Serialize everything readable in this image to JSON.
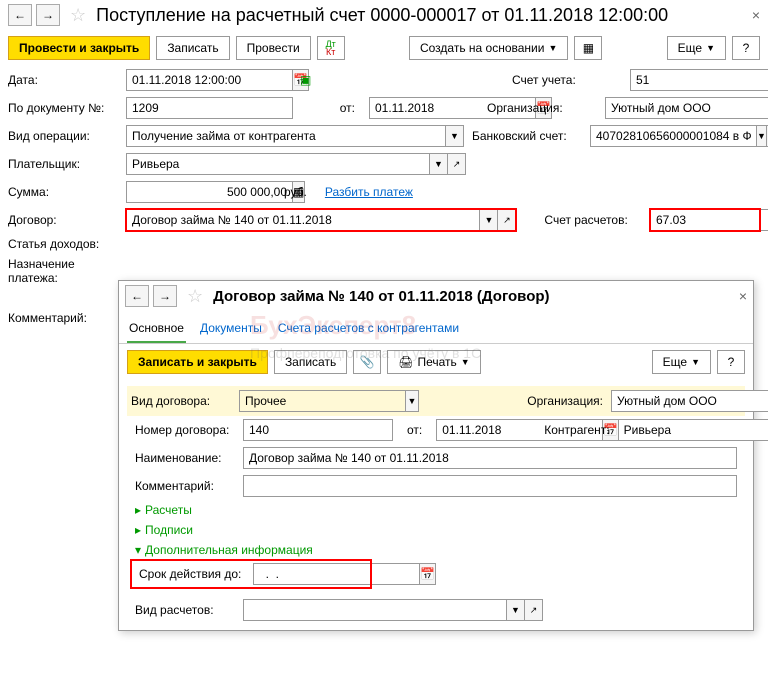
{
  "main": {
    "title": "Поступление на расчетный счет 0000-000017 от 01.11.2018 12:00:00",
    "actions": {
      "post_close": "Провести и закрыть",
      "save": "Записать",
      "post": "Провести",
      "create_based": "Создать на основании",
      "more": "Еще"
    },
    "fields": {
      "date_label": "Дата:",
      "date_value": "01.11.2018 12:00:00",
      "account_label": "Счет учета:",
      "account_value": "51",
      "docnum_label": "По документу №:",
      "docnum_value": "1209",
      "from_label": "от:",
      "from_value": "01.11.2018",
      "org_label": "Организация:",
      "org_value": "Уютный дом ООО",
      "optype_label": "Вид операции:",
      "optype_value": "Получение займа от контрагента",
      "bank_label": "Банковский счет:",
      "bank_value": "40702810656000001084 в Ф",
      "payer_label": "Плательщик:",
      "payer_value": "Ривьера",
      "sum_label": "Сумма:",
      "sum_value": "500 000,00",
      "currency": "руб.",
      "split_link": "Разбить платеж",
      "contract_label": "Договор:",
      "contract_value": "Договор займа № 140 от 01.11.2018",
      "settlement_label": "Счет расчетов:",
      "settlement_value": "67.03",
      "income_label": "Статья доходов:",
      "purpose_label": "Назначение платежа:",
      "comment_label": "Комментарий:"
    }
  },
  "dialog": {
    "title": "Договор займа № 140 от 01.11.2018 (Договор)",
    "tabs": {
      "main": "Основное",
      "docs": "Документы",
      "accounts": "Счета расчетов с контрагентами"
    },
    "actions": {
      "save_close": "Записать и закрыть",
      "save": "Записать",
      "print": "Печать",
      "more": "Еще"
    },
    "fields": {
      "type_label": "Вид договора:",
      "type_value": "Прочее",
      "org_label": "Организация:",
      "org_value": "Уютный дом ООО",
      "num_label": "Номер договора:",
      "num_value": "140",
      "from_label": "от:",
      "from_value": "01.11.2018",
      "contragent_label": "Контрагент:",
      "contragent_value": "Ривьера",
      "name_label": "Наименование:",
      "name_value": "Договор займа № 140 от 01.11.2018",
      "comment_label": "Комментарий:",
      "calc_expand": "Расчеты",
      "sign_expand": "Подписи",
      "addinfo_expand": "Дополнительная информация",
      "validity_label": "Срок действия до:",
      "validity_value": "  .  .    ",
      "calctype_label": "Вид расчетов:"
    }
  },
  "watermark": {
    "line1": "БухЭксперт8",
    "line2": "Профпереподготовка по учёту в 1С"
  }
}
